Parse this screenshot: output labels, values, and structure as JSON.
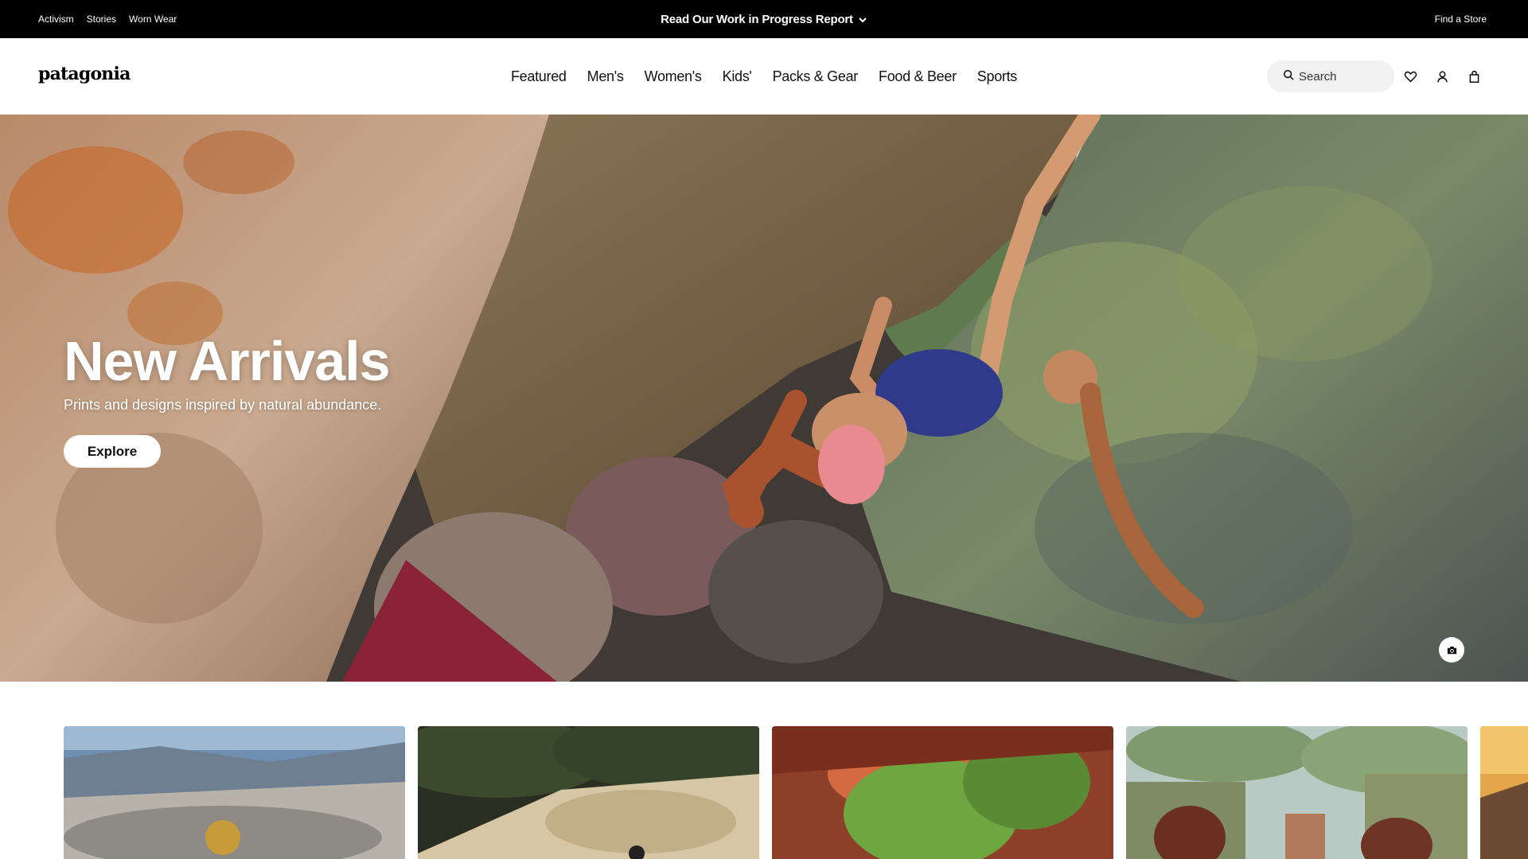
{
  "utility": {
    "links": [
      "Activism",
      "Stories",
      "Worn Wear"
    ],
    "promo": "Read Our Work in Progress Report",
    "find_store": "Find a Store"
  },
  "header": {
    "logo": "patagonia",
    "nav": [
      "Featured",
      "Men's",
      "Women's",
      "Kids'",
      "Packs & Gear",
      "Food & Beer",
      "Sports"
    ],
    "search_placeholder": "Search",
    "icons": [
      "heart-icon",
      "user-icon",
      "bag-icon"
    ]
  },
  "hero": {
    "title": "New Arrivals",
    "subtitle": "Prints and designs inspired by natural abundance.",
    "cta": "Explore",
    "photo_credit_icon": "camera-icon"
  },
  "cards": {
    "count": 5,
    "scenes": [
      "mountain-overlook",
      "granite-slab",
      "red-rock-arch",
      "garden-fence",
      "sunset-coast"
    ]
  },
  "colors": {
    "utility_bg": "#000000",
    "search_bg": "#f1f1f1",
    "button_bg": "#ffffff"
  }
}
